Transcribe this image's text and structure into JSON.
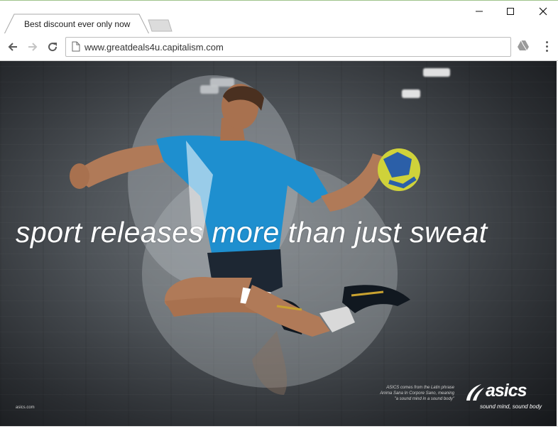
{
  "browser": {
    "tab_title": "Best discount ever only now",
    "url": "www.greatdeals4u.capitalism.com",
    "icons": [
      "back-arrow-icon",
      "forward-arrow-icon",
      "reload-icon",
      "page-icon",
      "extension-icon",
      "menu-dots-icon"
    ]
  },
  "ad": {
    "tagline": "sport releases more than just sweat",
    "note_line1": "ASICS comes from the Latin phrase",
    "note_line2": "Anima Sana In Corpore Sano, meaning",
    "note_line3": "\"a sound mind in a sound body\"",
    "site_credit": "asics.com",
    "brand_name": "asics",
    "brand_slogan": "sound mind, sound body"
  },
  "colors": {
    "accent_shirt": "#1e8fcf",
    "ball_yellow": "#cfd23a"
  }
}
